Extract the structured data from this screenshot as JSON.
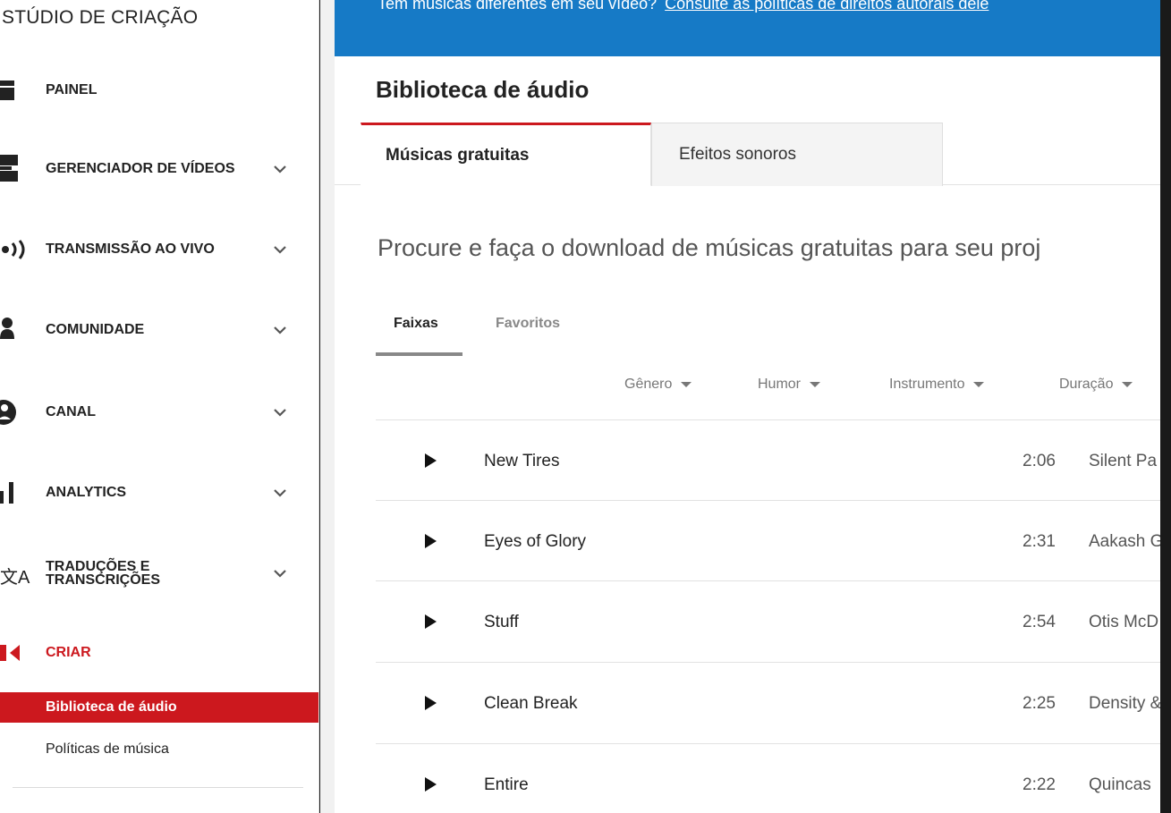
{
  "sidebar": {
    "studio_title": "STÚDIO DE CRIAÇÃO",
    "items": [
      {
        "label": "PAINEL",
        "icon": "dashboard-icon",
        "has_chevron": false
      },
      {
        "label": "GERENCIADOR DE VÍDEOS",
        "icon": "video-manager-icon",
        "has_chevron": true
      },
      {
        "label": "TRANSMISSÃO AO VIVO",
        "icon": "live-stream-icon",
        "has_chevron": true
      },
      {
        "label": "COMUNIDADE",
        "icon": "community-icon",
        "has_chevron": true
      },
      {
        "label": "CANAL",
        "icon": "channel-icon",
        "has_chevron": true
      },
      {
        "label": "ANALYTICS",
        "icon": "analytics-icon",
        "has_chevron": true
      },
      {
        "label_line1": "TRADUÇÕES E",
        "label_line2": "TRANSCRIÇÕES",
        "icon": "translate-icon",
        "has_chevron": true
      },
      {
        "label": "CRIAR",
        "icon": "create-icon",
        "has_chevron": false,
        "active": true
      }
    ],
    "sub_items": [
      {
        "label": "Biblioteca de áudio",
        "selected": true
      },
      {
        "label": "Políticas de música",
        "selected": false
      }
    ]
  },
  "banner": {
    "text": "Tem músicas diferentes em seu vídeo?",
    "link": "Consulte as políticas de direitos autorais dele"
  },
  "main": {
    "title": "Biblioteca de áudio",
    "tabs": [
      {
        "label": "Músicas gratuitas",
        "active": true
      },
      {
        "label": "Efeitos sonoros",
        "active": false
      }
    ],
    "subtitle": "Procure e faça o download de músicas gratuitas para seu proj",
    "filter_tabs": [
      {
        "label": "Faixas",
        "active": true
      },
      {
        "label": "Favoritos",
        "active": false
      }
    ],
    "column_filters": [
      "Gênero",
      "Humor",
      "Instrumento",
      "Duração"
    ],
    "tracks": [
      {
        "title": "New Tires",
        "duration": "2:06",
        "artist": "Silent Pa"
      },
      {
        "title": "Eyes of Glory",
        "duration": "2:31",
        "artist": "Aakash G"
      },
      {
        "title": "Stuff",
        "duration": "2:54",
        "artist": "Otis McD"
      },
      {
        "title": "Clean Break",
        "duration": "2:25",
        "artist": "Density &"
      },
      {
        "title": "Entire",
        "duration": "2:22",
        "artist": "Quincas"
      }
    ]
  },
  "colors": {
    "accent_red": "#cc181e",
    "banner_blue": "#167ac6",
    "background": "#f1f1f1"
  }
}
